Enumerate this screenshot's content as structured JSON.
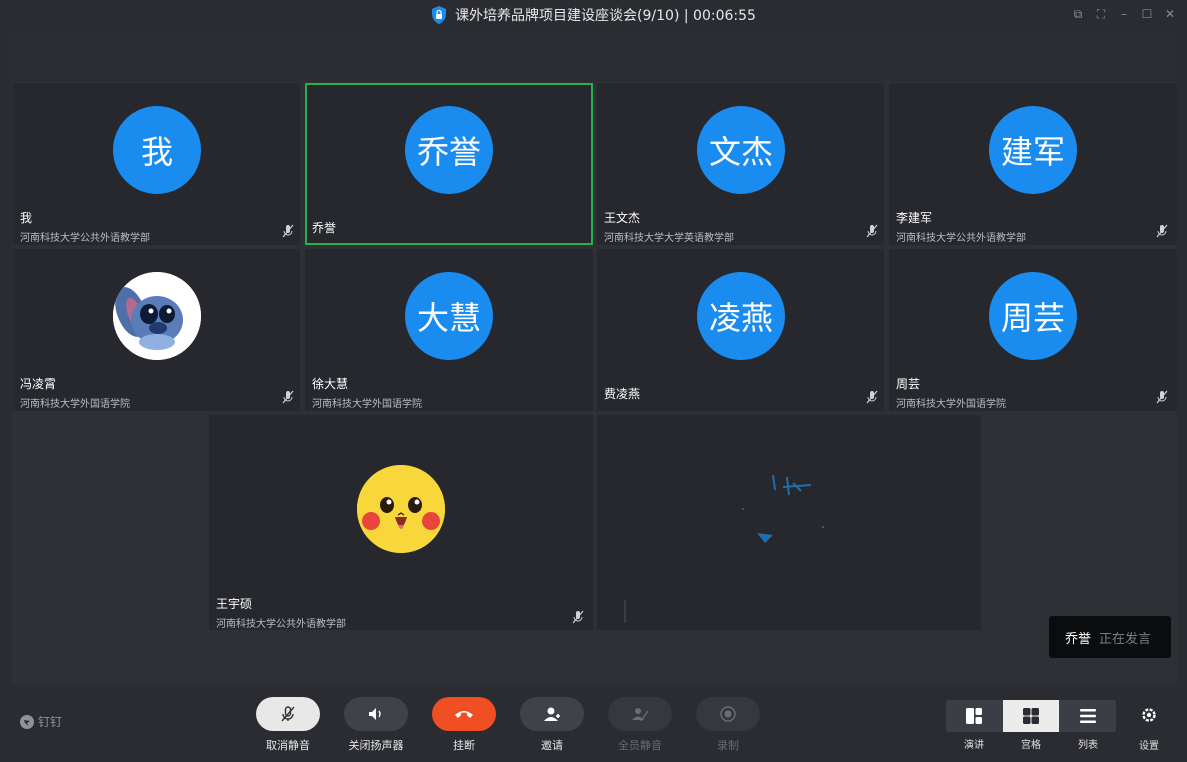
{
  "window": {
    "title": "课外培养品牌项目建设座谈会(9/10) | 00:06:55"
  },
  "participants": [
    {
      "avatar_text": "我",
      "name": "我",
      "org": "河南科技大学公共外语教学部"
    },
    {
      "avatar_text": "乔誉",
      "name": "乔誉",
      "org": ""
    },
    {
      "avatar_text": "文杰",
      "name": "王文杰",
      "org": "河南科技大学大学英语教学部"
    },
    {
      "avatar_text": "建军",
      "name": "李建军",
      "org": "河南科技大学公共外语教学部"
    },
    {
      "avatar_text": "",
      "name": "冯凌霄",
      "org": "河南科技大学外国语学院"
    },
    {
      "avatar_text": "大慧",
      "name": "徐大慧",
      "org": "河南科技大学外国语学院"
    },
    {
      "avatar_text": "凌燕",
      "name": "费凌燕",
      "org": ""
    },
    {
      "avatar_text": "周芸",
      "name": "周芸",
      "org": "河南科技大学外国语学院"
    },
    {
      "avatar_text": "",
      "name": "王宇硕",
      "org": "河南科技大学公共外语教学部"
    }
  ],
  "speaking": {
    "name": "乔誉",
    "status": "正在发言"
  },
  "bottom": {
    "brand": "钉钉",
    "controls": [
      {
        "label": "取消静音"
      },
      {
        "label": "关闭扬声器"
      },
      {
        "label": "挂断"
      },
      {
        "label": "邀请"
      },
      {
        "label": "全员静音"
      },
      {
        "label": "录制"
      }
    ],
    "layouts": [
      {
        "label": "演讲"
      },
      {
        "label": "宫格"
      },
      {
        "label": "列表"
      }
    ],
    "settings_label": "设置"
  },
  "colors": {
    "avatar_blue": "#1a8cf0",
    "active_border": "#24b04b",
    "hangup_red": "#f04e23"
  }
}
